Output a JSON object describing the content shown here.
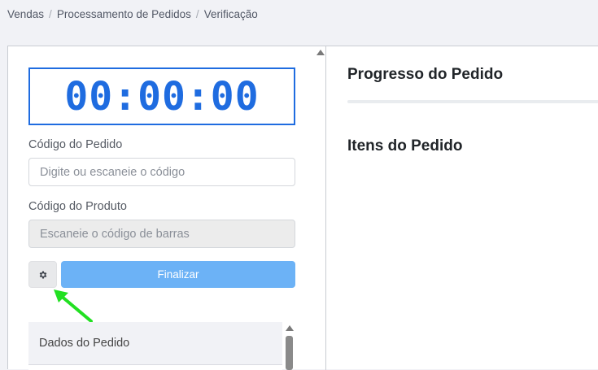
{
  "breadcrumb": [
    "Vendas",
    "Processamento de Pedidos",
    "Verificação"
  ],
  "timer": "00:00:00",
  "order_code": {
    "label": "Código do Pedido",
    "placeholder": "Digite ou escaneie o código",
    "value": ""
  },
  "product_code": {
    "label": "Código do Produto",
    "placeholder": "Escaneie o código de barras",
    "value": ""
  },
  "actions": {
    "settings_icon": "gear-icon",
    "finalize_label": "Finalizar"
  },
  "order_data": {
    "title": "Dados do Pedido"
  },
  "right_panel": {
    "progress_title": "Progresso do Pedido",
    "progress": 0,
    "items_title": "Itens do Pedido"
  },
  "colors": {
    "accent": "#1f6ce0",
    "finalize_button": "#6cb2f6",
    "annotation_arrow": "#22e022"
  }
}
